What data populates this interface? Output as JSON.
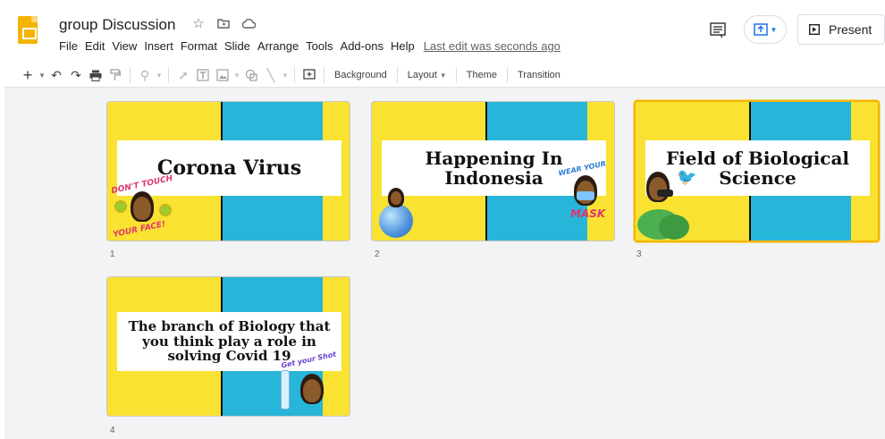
{
  "app": {
    "doc_title": "group Discussion",
    "menus": [
      "File",
      "Edit",
      "View",
      "Insert",
      "Format",
      "Slide",
      "Arrange",
      "Tools",
      "Add-ons",
      "Help"
    ],
    "last_edit": "Last edit was seconds ago",
    "present_label": "Present"
  },
  "toolbar": {
    "background_label": "Background",
    "layout_label": "Layout",
    "theme_label": "Theme",
    "transition_label": "Transition"
  },
  "slides": [
    {
      "number": "1",
      "title": "Corona Virus",
      "sticker_text_top": "DON'T TOUCH",
      "sticker_text_bottom": "YOUR FACE!",
      "selected": false
    },
    {
      "number": "2",
      "title": "Happening In Indonesia",
      "sticker_text_top": "WEAR YOUR",
      "sticker_text_bottom": "MASK",
      "selected": false
    },
    {
      "number": "3",
      "title": "Field of Biological Science",
      "selected": true
    },
    {
      "number": "4",
      "title": "The branch of Biology that you think play a role in solving Covid 19",
      "sticker_text_top": "Get your Shot",
      "selected": false
    }
  ],
  "colors": {
    "slide_yellow": "#f9e232",
    "slide_blue": "#27b5d9",
    "selection": "#f4b400",
    "accent_blue": "#1a73e8"
  }
}
